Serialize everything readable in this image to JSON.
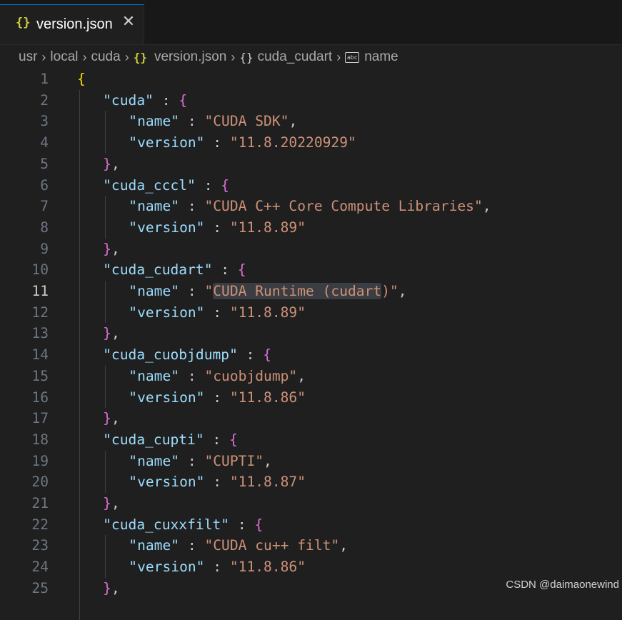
{
  "tab": {
    "icon": "{}",
    "label": "version.json",
    "close": "✕"
  },
  "breadcrumb": [
    "usr",
    "local",
    "cuda",
    "version.json",
    "cuda_cudart",
    "name"
  ],
  "editor": {
    "active_line": 11,
    "highlight": "CUDA Runtime (cudart",
    "lines": [
      {
        "n": "1",
        "t": [
          [
            "b1",
            "{"
          ]
        ]
      },
      {
        "n": "2",
        "t": [
          [
            "k",
            "\"cuda\""
          ],
          [
            "p",
            " : "
          ],
          [
            "b2",
            "{"
          ]
        ]
      },
      {
        "n": "3",
        "t": [
          [
            "k",
            "\"name\""
          ],
          [
            "p",
            " : "
          ],
          [
            "s",
            "\"CUDA SDK\""
          ],
          [
            "p",
            ","
          ]
        ]
      },
      {
        "n": "4",
        "t": [
          [
            "k",
            "\"version\""
          ],
          [
            "p",
            " : "
          ],
          [
            "s",
            "\"11.8.20220929\""
          ]
        ]
      },
      {
        "n": "5",
        "t": [
          [
            "b2",
            "}"
          ],
          [
            "p",
            ","
          ]
        ]
      },
      {
        "n": "6",
        "t": [
          [
            "k",
            "\"cuda_cccl\""
          ],
          [
            "p",
            " : "
          ],
          [
            "b2",
            "{"
          ]
        ]
      },
      {
        "n": "7",
        "t": [
          [
            "k",
            "\"name\""
          ],
          [
            "p",
            " : "
          ],
          [
            "s",
            "\"CUDA C++ Core Compute Libraries\""
          ],
          [
            "p",
            ","
          ]
        ]
      },
      {
        "n": "8",
        "t": [
          [
            "k",
            "\"version\""
          ],
          [
            "p",
            " : "
          ],
          [
            "s",
            "\"11.8.89\""
          ]
        ]
      },
      {
        "n": "9",
        "t": [
          [
            "b2",
            "}"
          ],
          [
            "p",
            ","
          ]
        ]
      },
      {
        "n": "10",
        "t": [
          [
            "k",
            "\"cuda_cudart\""
          ],
          [
            "p",
            " : "
          ],
          [
            "b2",
            "{"
          ]
        ]
      },
      {
        "n": "11",
        "t": [
          [
            "k",
            "\"name\""
          ],
          [
            "p",
            " : "
          ],
          [
            "s",
            "\""
          ],
          [
            "hl",
            "CUDA Runtime (cudart"
          ],
          [
            "s",
            ")\""
          ],
          [
            "p",
            ","
          ]
        ]
      },
      {
        "n": "12",
        "t": [
          [
            "k",
            "\"version\""
          ],
          [
            "p",
            " : "
          ],
          [
            "s",
            "\"11.8.89\""
          ]
        ]
      },
      {
        "n": "13",
        "t": [
          [
            "b2",
            "}"
          ],
          [
            "p",
            ","
          ]
        ]
      },
      {
        "n": "14",
        "t": [
          [
            "k",
            "\"cuda_cuobjdump\""
          ],
          [
            "p",
            " : "
          ],
          [
            "b2",
            "{"
          ]
        ]
      },
      {
        "n": "15",
        "t": [
          [
            "k",
            "\"name\""
          ],
          [
            "p",
            " : "
          ],
          [
            "s",
            "\"cuobjdump\""
          ],
          [
            "p",
            ","
          ]
        ]
      },
      {
        "n": "16",
        "t": [
          [
            "k",
            "\"version\""
          ],
          [
            "p",
            " : "
          ],
          [
            "s",
            "\"11.8.86\""
          ]
        ]
      },
      {
        "n": "17",
        "t": [
          [
            "b2",
            "}"
          ],
          [
            "p",
            ","
          ]
        ]
      },
      {
        "n": "18",
        "t": [
          [
            "k",
            "\"cuda_cupti\""
          ],
          [
            "p",
            " : "
          ],
          [
            "b2",
            "{"
          ]
        ]
      },
      {
        "n": "19",
        "t": [
          [
            "k",
            "\"name\""
          ],
          [
            "p",
            " : "
          ],
          [
            "s",
            "\"CUPTI\""
          ],
          [
            "p",
            ","
          ]
        ]
      },
      {
        "n": "20",
        "t": [
          [
            "k",
            "\"version\""
          ],
          [
            "p",
            " : "
          ],
          [
            "s",
            "\"11.8.87\""
          ]
        ]
      },
      {
        "n": "21",
        "t": [
          [
            "b2",
            "}"
          ],
          [
            "p",
            ","
          ]
        ]
      },
      {
        "n": "22",
        "t": [
          [
            "k",
            "\"cuda_cuxxfilt\""
          ],
          [
            "p",
            " : "
          ],
          [
            "b2",
            "{"
          ]
        ]
      },
      {
        "n": "23",
        "t": [
          [
            "k",
            "\"name\""
          ],
          [
            "p",
            " : "
          ],
          [
            "s",
            "\"CUDA cu++ filt\""
          ],
          [
            "p",
            ","
          ]
        ]
      },
      {
        "n": "24",
        "t": [
          [
            "k",
            "\"version\""
          ],
          [
            "p",
            " : "
          ],
          [
            "s",
            "\"11.8.86\""
          ]
        ]
      },
      {
        "n": "25",
        "t": [
          [
            "b2",
            "}"
          ],
          [
            "p",
            ","
          ]
        ]
      }
    ]
  },
  "watermark": "CSDN @daimaonewind"
}
